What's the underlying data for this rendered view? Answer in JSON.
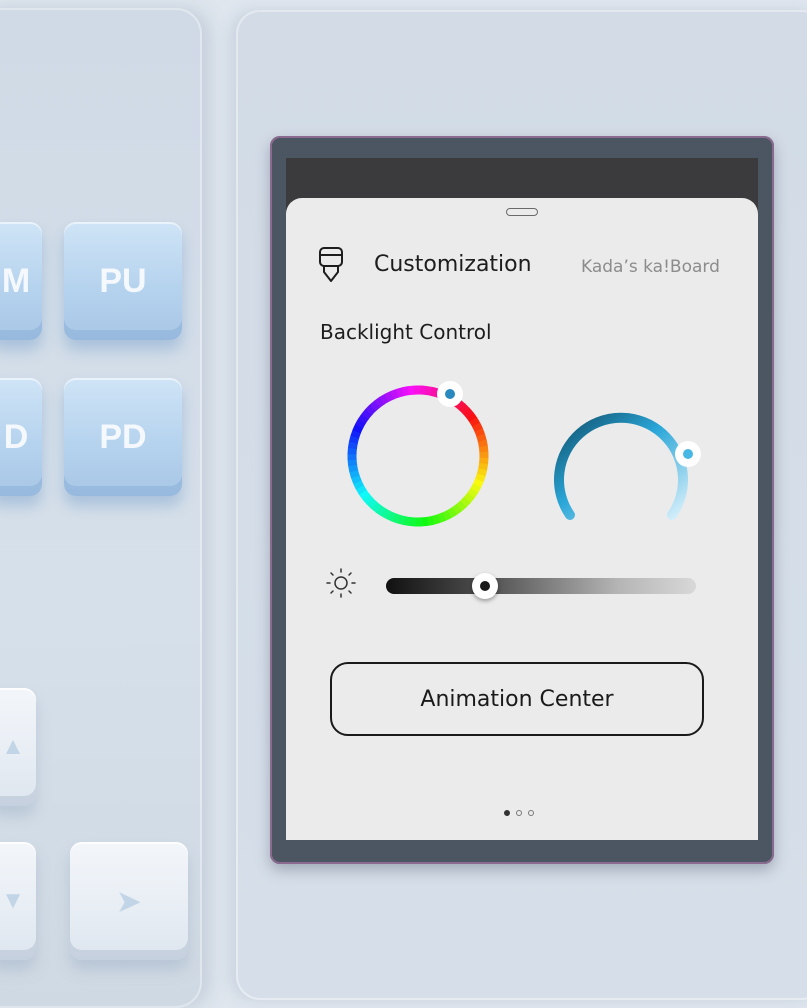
{
  "keyboard": {
    "keys": [
      {
        "label": "M"
      },
      {
        "label": "PU"
      },
      {
        "label": "D"
      },
      {
        "label": "PD"
      },
      {
        "label": "▲"
      },
      {
        "label": "▼"
      },
      {
        "label": "➤"
      }
    ]
  },
  "panel": {
    "title": "Customization",
    "device_name": "Kada’s ka!Board",
    "title_icon": "customization-icon",
    "section_title": "Backlight Control",
    "color_wheel": {
      "icon": "hue-ring"
    },
    "saturation_dial": {
      "icon": "saturation-arc"
    },
    "brightness": {
      "icon": "brightness-icon",
      "level": 0.32
    },
    "animation_button_label": "Animation Center",
    "pagination": {
      "total": 3,
      "active": 0
    }
  },
  "colors": {
    "sheet": "#ebebeb",
    "accent": "#2aa6d8",
    "text": "#1d1d1d",
    "muted": "#8c8c8c"
  }
}
